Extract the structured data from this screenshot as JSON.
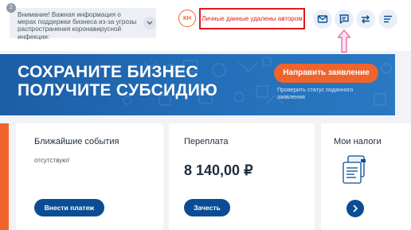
{
  "notice": {
    "badge": "2",
    "text": "Внимание! Важная информация о мерах поддержки бизнеса из-за угрозы распространения коронавирусной инфекции:"
  },
  "user": {
    "initials": "КН",
    "name": "Личные данные удалены автором"
  },
  "header_icons": [
    "mail-icon",
    "chat-icon",
    "swap-arrows-icon",
    "menu-icon"
  ],
  "banner": {
    "title_line1": "СОХРАНИТЕ БИЗНЕС",
    "title_line2": "ПОЛУЧИТЕ СУБСИДИЮ",
    "cta_label": "Направить заявление",
    "status_link": "Проверить статус поданного заявления"
  },
  "cards": {
    "events": {
      "title": "Ближайшие события",
      "subtitle": "отсутствуют",
      "button": "Внести платеж"
    },
    "overpayment": {
      "title": "Переплата",
      "amount": "8 140,00 ₽",
      "button": "Зачесть"
    },
    "taxes": {
      "title": "Мои налоги"
    }
  },
  "colors": {
    "accent": "#f0642c",
    "brand_blue": "#0b4d94",
    "banner_blue": "#1c5ea6",
    "highlight_red": "#e01a1a",
    "annotation_pink": "#f06cb0"
  }
}
